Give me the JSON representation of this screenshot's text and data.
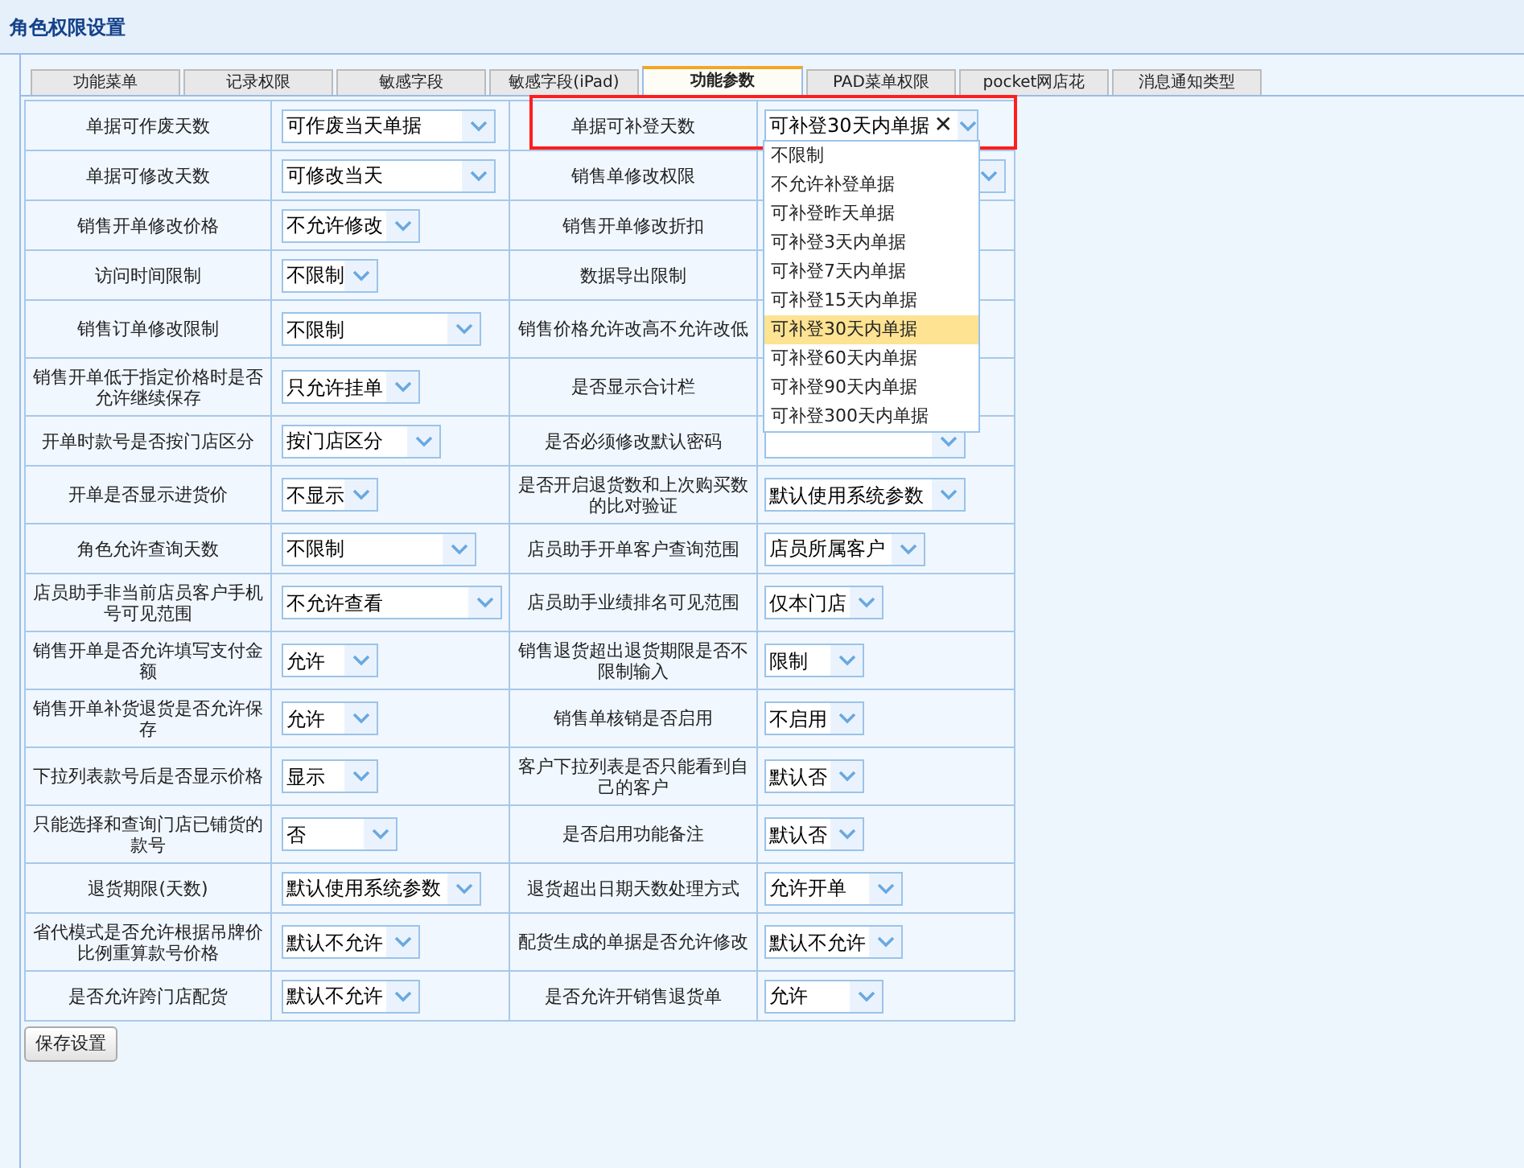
{
  "window": {
    "title": "角色权限设置"
  },
  "tabs": [
    {
      "label": "功能菜单",
      "selected": false
    },
    {
      "label": "记录权限",
      "selected": false
    },
    {
      "label": "敏感字段",
      "selected": false
    },
    {
      "label": "敏感字段(iPad)",
      "selected": false
    },
    {
      "label": "功能参数",
      "selected": true
    },
    {
      "label": "PAD菜单权限",
      "selected": false
    },
    {
      "label": "pocket网店花",
      "selected": false
    },
    {
      "label": "消息通知类型",
      "selected": false
    }
  ],
  "rows": [
    {
      "left": {
        "label": "单据可作废天数",
        "value": "可作废当天单据"
      },
      "right": {
        "label": "单据可补登天数",
        "value": "可补登30天内单据",
        "clear": "✕"
      }
    },
    {
      "left": {
        "label": "单据可修改天数",
        "value": "可修改当天"
      },
      "right": {
        "label": "销售单修改权限"
      }
    },
    {
      "left": {
        "label": "销售开单修改价格",
        "value": "不允许修改"
      },
      "right": {
        "label": "销售开单修改折扣"
      }
    },
    {
      "left": {
        "label": "访问时间限制",
        "value": "不限制"
      },
      "right": {
        "label": "数据导出限制"
      }
    },
    {
      "left": {
        "label": "销售订单修改限制",
        "value": "不限制"
      },
      "right": {
        "label": "销售价格允许改高不允许改低"
      }
    },
    {
      "left": {
        "label": "销售开单低于指定价格时是否允许继续保存",
        "value": "只允许挂单"
      },
      "right": {
        "label": "是否显示合计栏"
      }
    },
    {
      "left": {
        "label": "开单时款号是否按门店区分",
        "value": "按门店区分"
      },
      "right": {
        "label": "是否必须修改默认密码"
      }
    },
    {
      "left": {
        "label": "开单是否显示进货价",
        "value": "不显示"
      },
      "right": {
        "label": "是否开启退货数和上次购买数的比对验证",
        "value": "默认使用系统参数"
      }
    },
    {
      "left": {
        "label": "角色允许查询天数",
        "value": "不限制"
      },
      "right": {
        "label": "店员助手开单客户查询范围",
        "value": "店员所属客户"
      }
    },
    {
      "left": {
        "label": "店员助手非当前店员客户手机号可见范围",
        "value": "不允许查看"
      },
      "right": {
        "label": "店员助手业绩排名可见范围",
        "value": "仅本门店"
      }
    },
    {
      "left": {
        "label": "销售开单是否允许填写支付金额",
        "value": "允许"
      },
      "right": {
        "label": "销售退货超出退货期限是否不限制输入",
        "value": "限制"
      }
    },
    {
      "left": {
        "label": "销售开单补货退货是否允许保存",
        "value": "允许"
      },
      "right": {
        "label": "销售单核销是否启用",
        "value": "不启用"
      }
    },
    {
      "left": {
        "label": "下拉列表款号后是否显示价格",
        "value": "显示"
      },
      "right": {
        "label": "客户下拉列表是否只能看到自己的客户",
        "value": "默认否"
      }
    },
    {
      "left": {
        "label": "只能选择和查询门店已铺货的款号",
        "value": "否"
      },
      "right": {
        "label": "是否启用功能备注",
        "value": "默认否"
      }
    },
    {
      "left": {
        "label": "退货期限(天数)",
        "value": "默认使用系统参数"
      },
      "right": {
        "label": "退货超出日期天数处理方式",
        "value": "允许开单"
      }
    },
    {
      "left": {
        "label": "省代模式是否允许根据吊牌价比例重算款号价格",
        "value": "默认不允许"
      },
      "right": {
        "label": "配货生成的单据是否允许修改",
        "value": "默认不允许"
      }
    },
    {
      "left": {
        "label": "是否允许跨门店配货",
        "value": "默认不允许"
      },
      "right": {
        "label": "是否允许开销售退货单",
        "value": "允许"
      }
    }
  ],
  "dropdown": {
    "options": [
      {
        "label": "不限制",
        "selected": false
      },
      {
        "label": "不允许补登单据",
        "selected": false
      },
      {
        "label": "可补登昨天单据",
        "selected": false
      },
      {
        "label": "可补登3天内单据",
        "selected": false
      },
      {
        "label": "可补登7天内单据",
        "selected": false
      },
      {
        "label": "可补登15天内单据",
        "selected": false
      },
      {
        "label": "可补登30天内单据",
        "selected": true
      },
      {
        "label": "可补登60天内单据",
        "selected": false
      },
      {
        "label": "可补登90天内单据",
        "selected": false
      },
      {
        "label": "可补登300天内单据",
        "selected": false
      }
    ]
  },
  "save_button": "保存设置"
}
